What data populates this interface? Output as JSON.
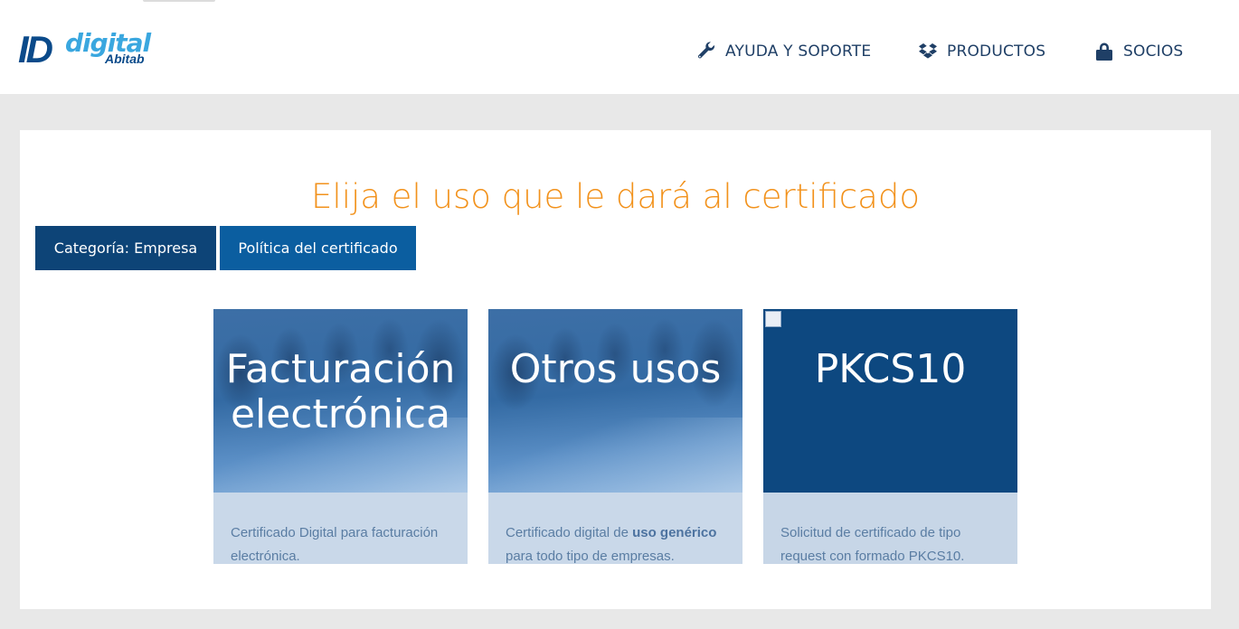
{
  "header": {
    "logo": {
      "id": "ID",
      "digital": "digital",
      "brand": "Abitab"
    },
    "nav": [
      {
        "label": "AYUDA Y SOPORTE",
        "icon": "wrench-icon"
      },
      {
        "label": "PRODUCTOS",
        "icon": "dropbox-icon"
      },
      {
        "label": "SOCIOS",
        "icon": "lock-icon"
      }
    ]
  },
  "main": {
    "title": "Elija el uso que le dará al certificado",
    "breadcrumb": [
      {
        "label": "Categoría: Empresa"
      },
      {
        "label": "Política del certificado"
      }
    ],
    "cards": [
      {
        "title_line1": "Facturación",
        "title_line2": "electrónica",
        "desc_line1": "Certificado Digital para facturación",
        "desc_line2": "electrónica."
      },
      {
        "title_line1": "Otros usos",
        "desc_prefix": "Certificado digital de ",
        "desc_bold": "uso genérico",
        "desc_line2": "para todo tipo de empresas."
      },
      {
        "title_line1": "PKCS10",
        "desc_line1": "Solicitud de certificado de tipo",
        "desc_line2": "request con formado PKCS10."
      }
    ]
  },
  "colors": {
    "accent_orange": "#f2921c",
    "navy": "#0d4477",
    "blue": "#0b5ea0",
    "nav_text": "#1f3f66"
  }
}
